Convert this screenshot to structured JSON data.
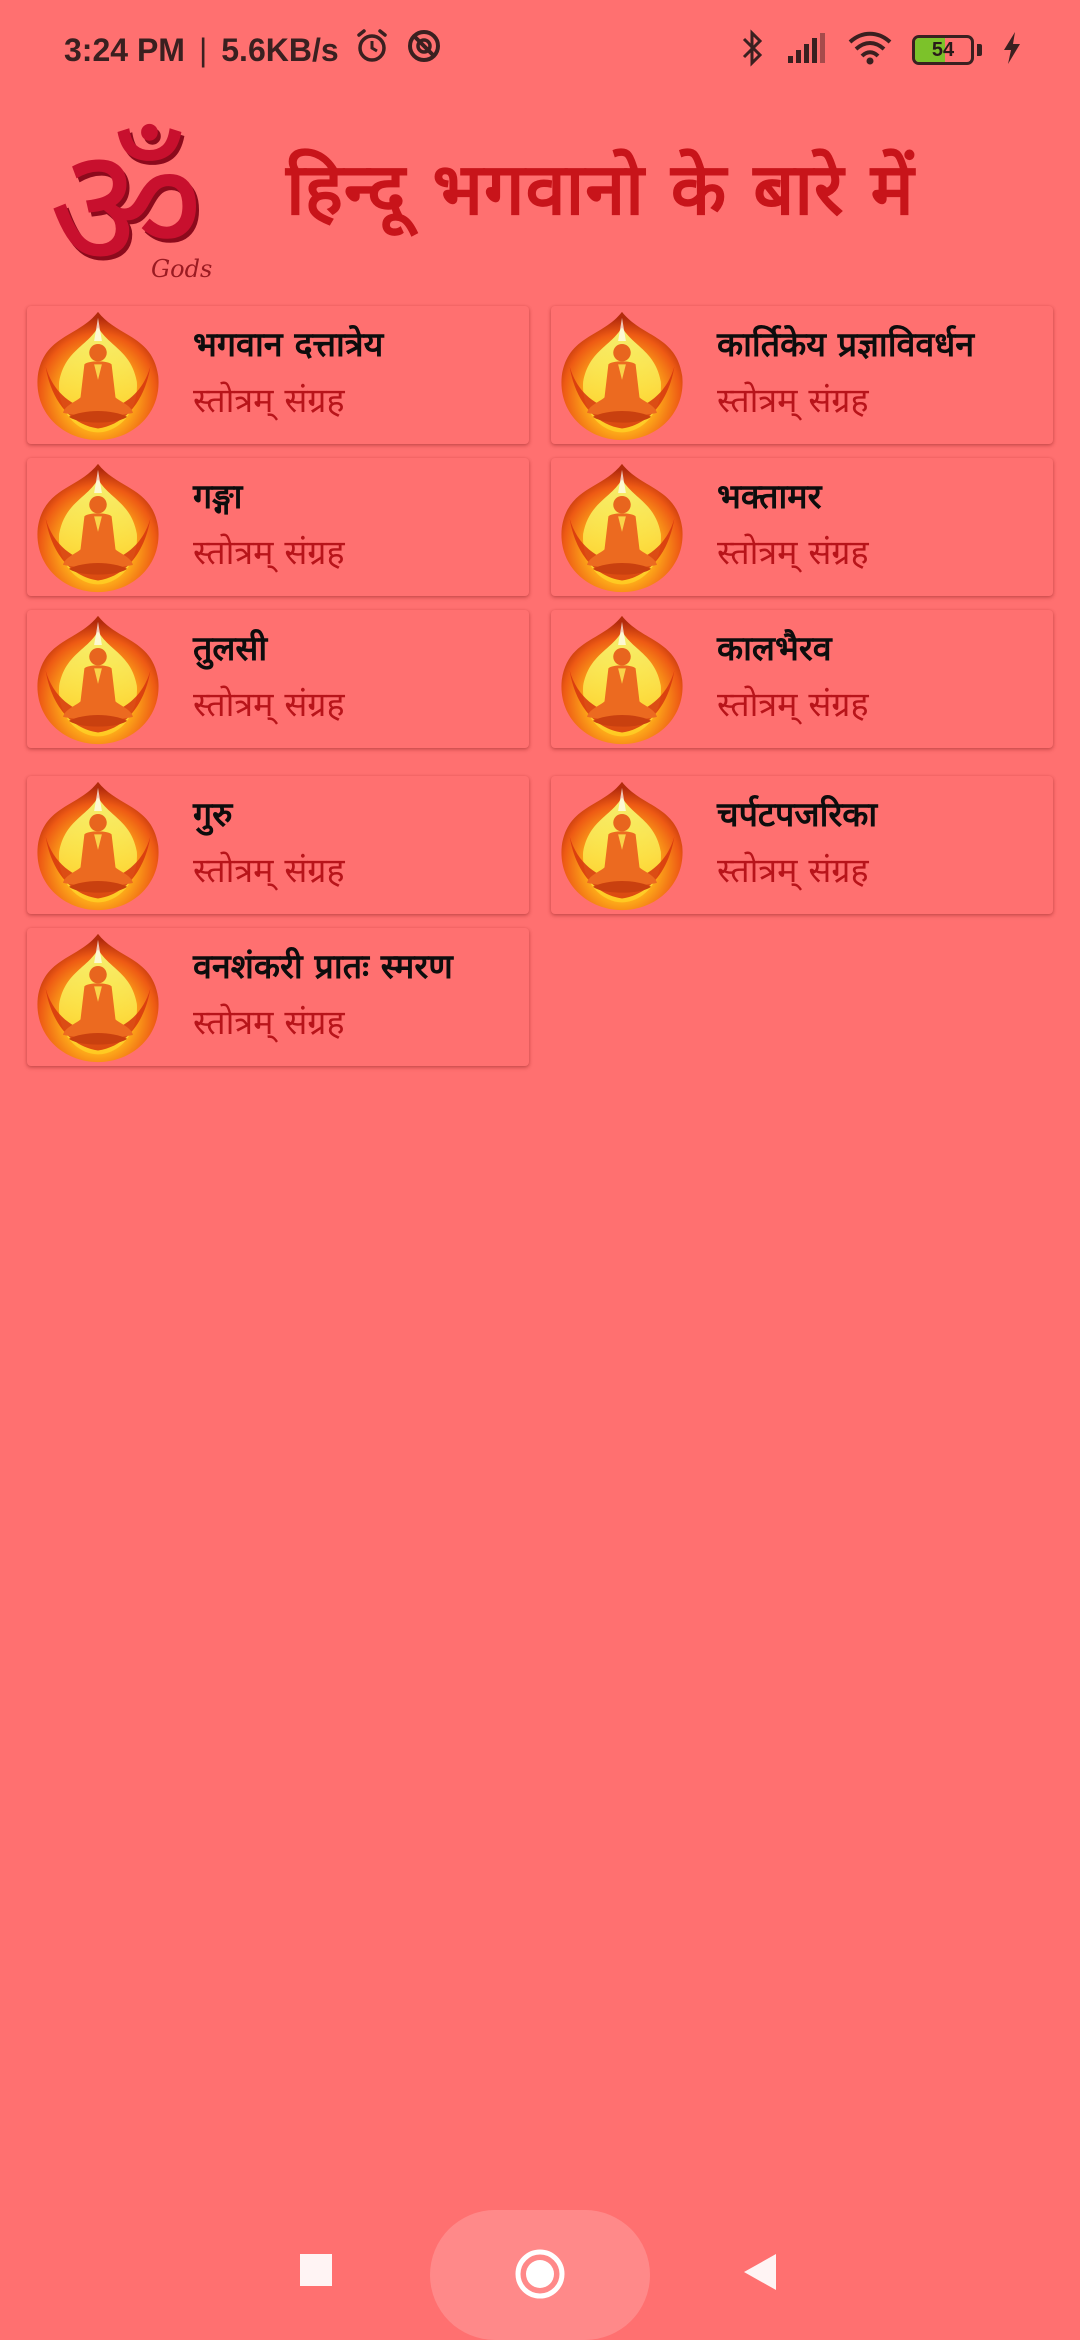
{
  "status_bar": {
    "time": "3:24 PM",
    "separator": "|",
    "net_speed": "5.6KB/s",
    "battery_level": "54",
    "battery_fraction": 0.54,
    "icons": [
      "alarm-icon",
      "dnd-icon",
      "bluetooth-icon",
      "signal-icon",
      "wifi-icon",
      "battery-icon",
      "charging-icon"
    ]
  },
  "header": {
    "logo_glyph": "ॐ",
    "logo_caption": "Gods",
    "title": "हिन्दू भगवानो के बारे में"
  },
  "items": [
    {
      "title": "भगवान दत्तात्रेय",
      "subtitle": "स्तोत्रम् संग्रह"
    },
    {
      "title": "कार्तिकेय प्रज्ञाविवर्धन",
      "subtitle": "स्तोत्रम् संग्रह"
    },
    {
      "title": "गङ्गा",
      "subtitle": "स्तोत्रम् संग्रह"
    },
    {
      "title": "भक्तामर",
      "subtitle": "स्तोत्रम् संग्रह"
    },
    {
      "title": "तुलसी",
      "subtitle": "स्तोत्रम् संग्रह"
    },
    {
      "title": "कालभैरव",
      "subtitle": "स्तोत्रम् संग्रह"
    },
    {
      "title": "गुरु",
      "subtitle": "स्तोत्रम् संग्रह"
    },
    {
      "title": "चर्पटपजरिका",
      "subtitle": "स्तोत्रम् संग्रह"
    },
    {
      "title": "वनशंकरी प्रातः स्मरण",
      "subtitle": "स्तोत्रम् संग्रह"
    }
  ],
  "nav": {
    "icons": [
      "recents-icon",
      "home-icon",
      "back-icon"
    ]
  },
  "colors": {
    "background": "#ff7070",
    "title_red": "#c8141a",
    "subtitle_red": "#b8141a"
  }
}
